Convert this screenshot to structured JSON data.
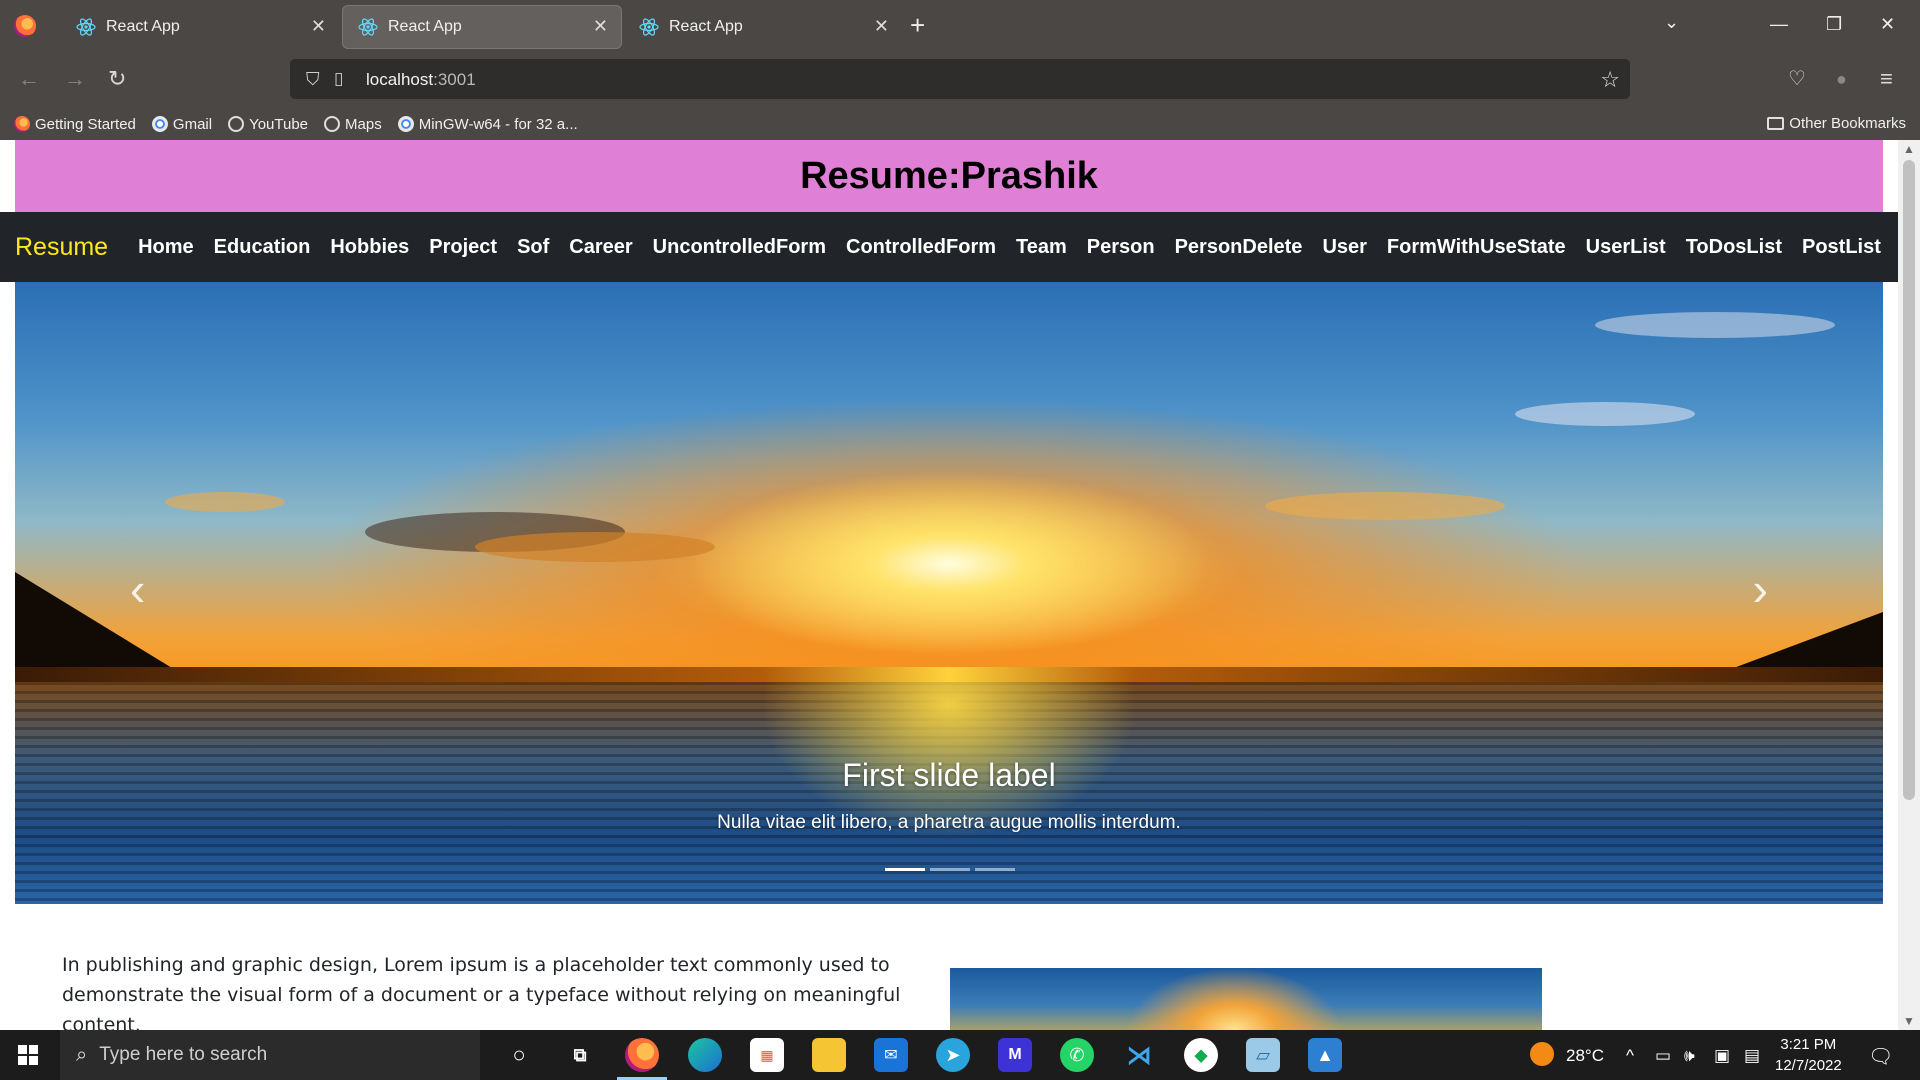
{
  "browser": {
    "tabs": [
      {
        "title": "React App",
        "active": false
      },
      {
        "title": "React App",
        "active": true
      },
      {
        "title": "React App",
        "active": false
      }
    ],
    "url_host": "localhost",
    "url_port": ":3001",
    "bookmarks": [
      {
        "label": "Getting Started",
        "icon": "firefox-icon"
      },
      {
        "label": "Gmail",
        "icon": "google-icon"
      },
      {
        "label": "YouTube",
        "icon": "globe-icon"
      },
      {
        "label": "Maps",
        "icon": "globe-icon"
      },
      {
        "label": "MinGW-w64 - for 32 a...",
        "icon": "google-icon"
      }
    ],
    "other_bookmarks": "Other Bookmarks"
  },
  "page": {
    "header_title": "Resume:Prashik",
    "brand": "Resume",
    "nav_links": [
      "Home",
      "Education",
      "Hobbies",
      "Project",
      "Sof",
      "Career",
      "UncontrolledForm",
      "ControlledForm",
      "Team",
      "Person",
      "PersonDelete",
      "User",
      "FormWithUseState",
      "UserList",
      "ToDosList",
      "PostList"
    ],
    "carousel": {
      "caption_title": "First slide label",
      "caption_text": "Nulla vitae elit libero, a pharetra augue mollis interdum.",
      "slide_count": 3,
      "active_slide": 1
    },
    "body_text": "In publishing and graphic design, Lorem ipsum is a placeholder text commonly used to demonstrate the visual form of a document or a typeface without relying on meaningful content."
  },
  "taskbar": {
    "search_placeholder": "Type here to search",
    "temperature": "28°C",
    "time": "3:21 PM",
    "date": "12/7/2022"
  },
  "colors": {
    "header_bg": "#e07fd6",
    "nav_bg": "#212529",
    "brand": "#ffe81a"
  }
}
